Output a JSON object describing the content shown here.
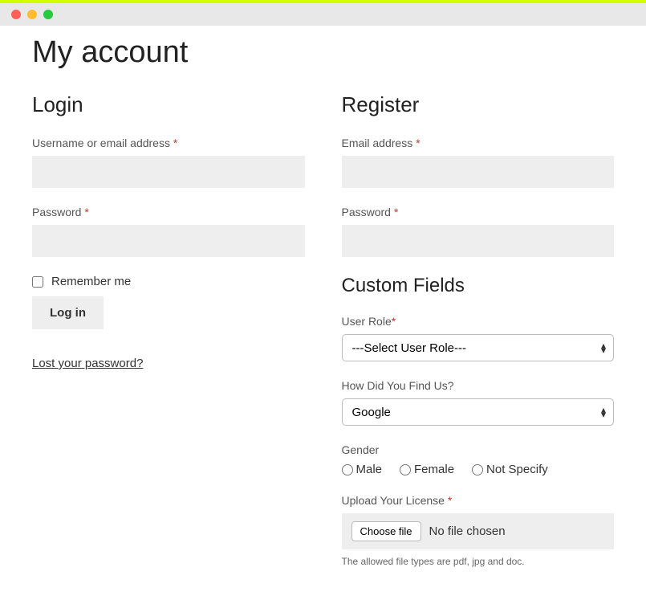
{
  "page_title": "My account",
  "login": {
    "title": "Login",
    "username_label": "Username or email address",
    "username_req": "*",
    "password_label": "Password",
    "password_req": "*",
    "remember_label": "Remember me",
    "submit_label": "Log in",
    "lost_password_label": "Lost your password?"
  },
  "register": {
    "title": "Register",
    "email_label": "Email address",
    "email_req": "*",
    "password_label": "Password",
    "password_req": "*"
  },
  "custom": {
    "title": "Custom Fields",
    "user_role": {
      "label": "User Role",
      "req": "*",
      "placeholder": "---Select User Role---"
    },
    "find_us": {
      "label": "How Did You Find Us?",
      "selected": "Google"
    },
    "gender": {
      "label": "Gender",
      "options": [
        "Male",
        "Female",
        "Not Specify"
      ]
    },
    "license": {
      "label": "Upload Your License",
      "req": "*",
      "button": "Choose file",
      "status": "No file chosen",
      "hint": "The allowed file types are pdf, jpg and doc."
    }
  }
}
